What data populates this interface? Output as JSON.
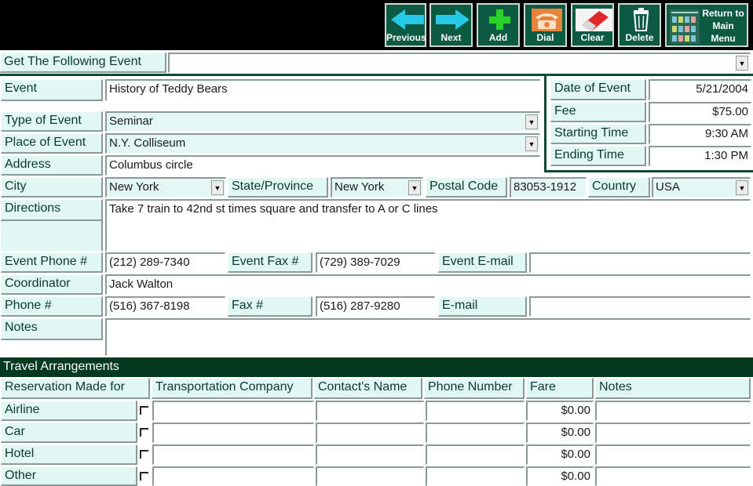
{
  "toolbar": {
    "buttons": [
      {
        "id": "previous",
        "label": "Previous",
        "icon": "arrow-left-icon"
      },
      {
        "id": "next",
        "label": "Next",
        "icon": "arrow-right-icon"
      },
      {
        "id": "add",
        "label": "Add",
        "icon": "plus-icon"
      },
      {
        "id": "dial",
        "label": "Dial",
        "icon": "telephone-icon"
      },
      {
        "id": "clear",
        "label": "Clear",
        "icon": "eraser-icon"
      },
      {
        "id": "delete",
        "label": "Delete",
        "icon": "trash-icon"
      },
      {
        "id": "return",
        "label": "Return to Main Menu",
        "line1": "Return to",
        "line2": "Main",
        "line3": "Menu",
        "icon": "main-menu-thumbnail-icon"
      }
    ]
  },
  "get_event": {
    "label": "Get The Following Event",
    "value": ""
  },
  "event": {
    "event_label": "Event",
    "event_value": "History of Teddy Bears",
    "type_label": "Type of Event",
    "type_value": "Seminar",
    "place_label": "Place of Event",
    "place_value": "N.Y. Colliseum",
    "address_label": "Address",
    "address_value": "Columbus circle",
    "city_label": "City",
    "city_value": "New York",
    "state_label": "State/Province",
    "state_value": "New York",
    "postal_label": "Postal Code",
    "postal_value": "83053-1912",
    "country_label": "Country",
    "country_value": "USA",
    "directions_label": "Directions",
    "directions_value": "Take 7 train to 42nd st times square and transfer to A or C lines",
    "phone_label": "Event Phone #",
    "phone_value": "(212) 289-7340",
    "fax_label": "Event Fax #",
    "fax_value": "(729) 389-7029",
    "email_label": "Event E-mail",
    "email_value": ""
  },
  "schedule": {
    "date_label": "Date of Event",
    "date_value": "5/21/2004",
    "fee_label": "Fee",
    "fee_value": "$75.00",
    "start_label": "Starting Time",
    "start_value": "9:30 AM",
    "end_label": "Ending Time",
    "end_value": "1:30 PM"
  },
  "coordinator": {
    "label": "Coordinator",
    "value": "Jack Walton",
    "phone_label": "Phone #",
    "phone_value": "(516) 367-8198",
    "fax_label": "Fax #",
    "fax_value": "(516) 287-9280",
    "email_label": "E-mail",
    "email_value": "",
    "notes_label": "Notes",
    "notes_value": ""
  },
  "travel": {
    "title": "Travel Arrangements",
    "columns": [
      "Reservation Made for",
      "Transportation Company",
      "Contact's Name",
      "Phone Number",
      "Fare",
      "Notes"
    ],
    "rows": [
      {
        "label": "Airline",
        "company": "",
        "contact": "",
        "phone": "",
        "fare": "$0.00",
        "notes": ""
      },
      {
        "label": "Car",
        "company": "",
        "contact": "",
        "phone": "",
        "fare": "$0.00",
        "notes": ""
      },
      {
        "label": "Hotel",
        "company": "",
        "contact": "",
        "phone": "",
        "fare": "$0.00",
        "notes": ""
      },
      {
        "label": "Other",
        "company": "",
        "contact": "",
        "phone": "",
        "fare": "$0.00",
        "notes": ""
      }
    ]
  },
  "colors": {
    "toolbar_bg": "#000000",
    "button_bg": "#0d5a43",
    "label_bg": "#e0f7f3",
    "section_bar": "#053a20",
    "label_text": "#0a3a2a"
  }
}
